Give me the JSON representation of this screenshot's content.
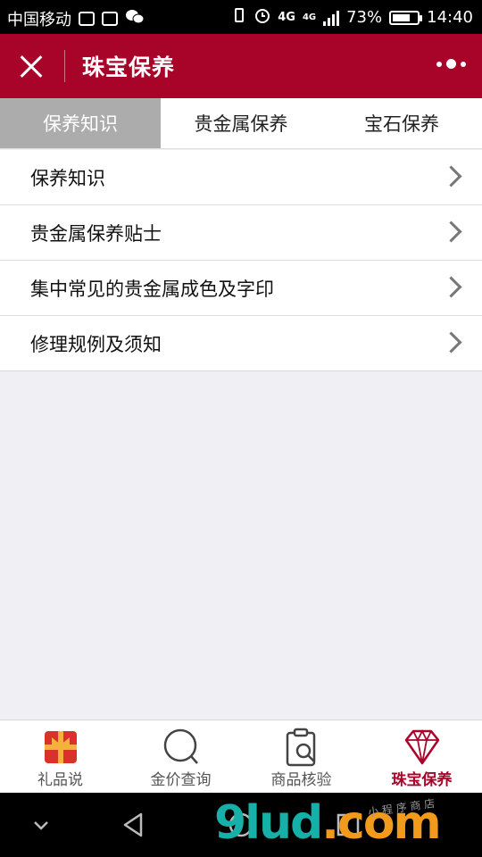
{
  "status_bar": {
    "carrier": "中国移动",
    "network": "4G",
    "battery": "73%",
    "battery_level": 0.73,
    "time": "14:40"
  },
  "header": {
    "title": "珠宝保养",
    "close_icon": "close-icon",
    "more_icon": "more-icon"
  },
  "tabs": [
    {
      "label": "保养知识",
      "active": true
    },
    {
      "label": "贵金属保养",
      "active": false
    },
    {
      "label": "宝石保养",
      "active": false
    }
  ],
  "list": [
    {
      "label": "保养知识"
    },
    {
      "label": "贵金属保养贴士"
    },
    {
      "label": "集中常见的贵金属成色及字印"
    },
    {
      "label": "修理规例及须知"
    }
  ],
  "tabbar": [
    {
      "label": "礼品说",
      "icon": "gift-icon",
      "active": false
    },
    {
      "label": "金价查询",
      "icon": "search-icon",
      "active": false
    },
    {
      "label": "商品核验",
      "icon": "clipboard-search-icon",
      "active": false
    },
    {
      "label": "珠宝保养",
      "icon": "diamond-icon",
      "active": true
    }
  ],
  "colors": {
    "brand": "#a8042a",
    "tab_active_bg": "#acacac"
  },
  "watermark": {
    "main": "9lud",
    "suffix": ".com",
    "small": "小 程 序 商 店"
  }
}
